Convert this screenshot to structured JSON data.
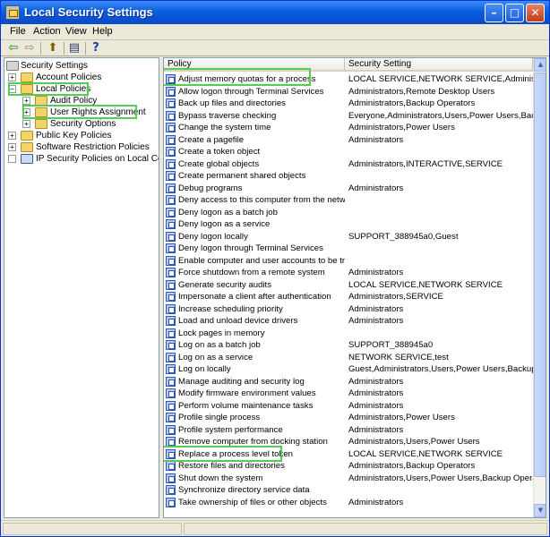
{
  "window": {
    "title": "Local Security Settings",
    "min_glyph": "–",
    "max_glyph": "□",
    "close_glyph": "✕"
  },
  "menu": [
    "File",
    "Action",
    "View",
    "Help"
  ],
  "toolbar": {
    "back_glyph": "⇦",
    "forward_glyph": "⇨",
    "up_glyph": "⬆",
    "export_glyph": "▤",
    "help_glyph": "?"
  },
  "tree": {
    "root": "Security Settings",
    "items": [
      {
        "label": "Account Policies",
        "expander": "+"
      },
      {
        "label": "Local Policies",
        "expander": "−"
      },
      {
        "label": "Audit Policy",
        "expander": "+"
      },
      {
        "label": "User Rights Assignment",
        "expander": "+"
      },
      {
        "label": "Security Options",
        "expander": "+"
      },
      {
        "label": "Public Key Policies",
        "expander": "+"
      },
      {
        "label": "Software Restriction Policies",
        "expander": "+"
      },
      {
        "label": "IP Security Policies on Local Computer",
        "expander": ""
      }
    ]
  },
  "list": {
    "headers": {
      "policy": "Policy",
      "setting": "Security Setting"
    },
    "rows": [
      {
        "policy": "Adjust memory quotas for a process",
        "setting": "LOCAL SERVICE,NETWORK SERVICE,Administrators"
      },
      {
        "policy": "Allow logon through Terminal Services",
        "setting": "Administrators,Remote Desktop Users"
      },
      {
        "policy": "Back up files and directories",
        "setting": "Administrators,Backup Operators"
      },
      {
        "policy": "Bypass traverse checking",
        "setting": "Everyone,Administrators,Users,Power Users,Backup O"
      },
      {
        "policy": "Change the system time",
        "setting": "Administrators,Power Users"
      },
      {
        "policy": "Create a pagefile",
        "setting": "Administrators"
      },
      {
        "policy": "Create a token object",
        "setting": ""
      },
      {
        "policy": "Create global objects",
        "setting": "Administrators,INTERACTIVE,SERVICE"
      },
      {
        "policy": "Create permanent shared objects",
        "setting": ""
      },
      {
        "policy": "Debug programs",
        "setting": "Administrators"
      },
      {
        "policy": "Deny access to this computer from the network",
        "setting": ""
      },
      {
        "policy": "Deny logon as a batch job",
        "setting": ""
      },
      {
        "policy": "Deny logon as a service",
        "setting": ""
      },
      {
        "policy": "Deny logon locally",
        "setting": "SUPPORT_388945a0,Guest"
      },
      {
        "policy": "Deny logon through Terminal Services",
        "setting": ""
      },
      {
        "policy": "Enable computer and user accounts to be tru...",
        "setting": ""
      },
      {
        "policy": "Force shutdown from a remote system",
        "setting": "Administrators"
      },
      {
        "policy": "Generate security audits",
        "setting": "LOCAL SERVICE,NETWORK SERVICE"
      },
      {
        "policy": "Impersonate a client after authentication",
        "setting": "Administrators,SERVICE"
      },
      {
        "policy": "Increase scheduling priority",
        "setting": "Administrators"
      },
      {
        "policy": "Load and unload device drivers",
        "setting": "Administrators"
      },
      {
        "policy": "Lock pages in memory",
        "setting": ""
      },
      {
        "policy": "Log on as a batch job",
        "setting": "SUPPORT_388945a0"
      },
      {
        "policy": "Log on as a service",
        "setting": "NETWORK SERVICE,test"
      },
      {
        "policy": "Log on locally",
        "setting": "Guest,Administrators,Users,Power Users,Backup Op"
      },
      {
        "policy": "Manage auditing and security log",
        "setting": "Administrators"
      },
      {
        "policy": "Modify firmware environment values",
        "setting": "Administrators"
      },
      {
        "policy": "Perform volume maintenance tasks",
        "setting": "Administrators"
      },
      {
        "policy": "Profile single process",
        "setting": "Administrators,Power Users"
      },
      {
        "policy": "Profile system performance",
        "setting": "Administrators"
      },
      {
        "policy": "Remove computer from docking station",
        "setting": "Administrators,Users,Power Users"
      },
      {
        "policy": "Replace a process level token",
        "setting": "LOCAL SERVICE,NETWORK SERVICE"
      },
      {
        "policy": "Restore files and directories",
        "setting": "Administrators,Backup Operators"
      },
      {
        "policy": "Shut down the system",
        "setting": "Administrators,Users,Power Users,Backup Operators"
      },
      {
        "policy": "Synchronize directory service data",
        "setting": ""
      },
      {
        "policy": "Take ownership of files or other objects",
        "setting": "Administrators"
      }
    ]
  },
  "scrollbar": {
    "up_glyph": "▲",
    "down_glyph": "▼"
  },
  "highlight_color": "#4fd04f"
}
